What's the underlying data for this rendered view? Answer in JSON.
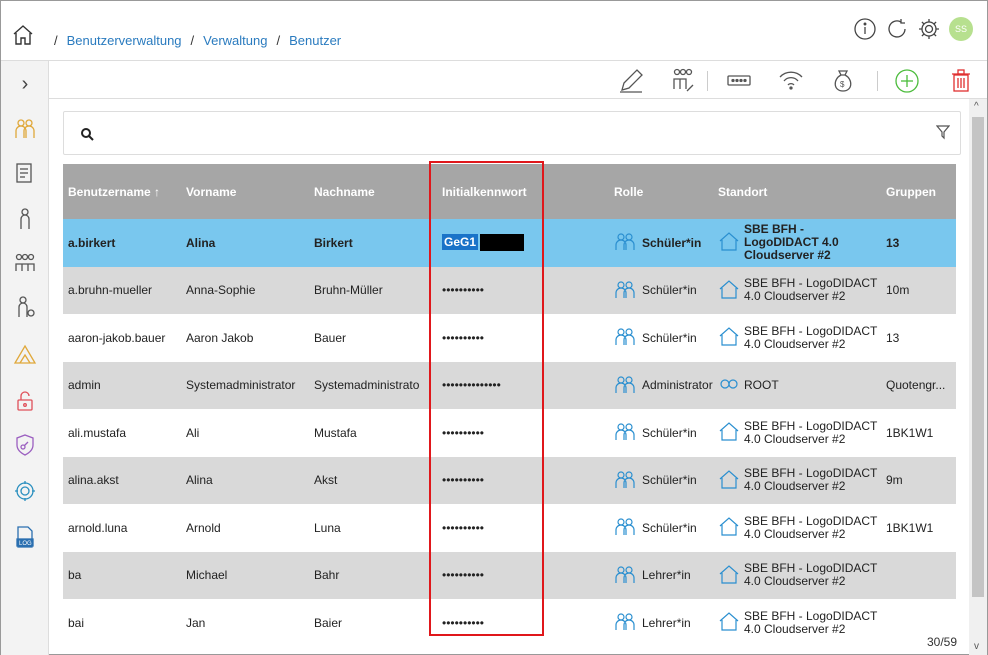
{
  "breadcrumb": {
    "items": [
      "Benutzerverwaltung",
      "Verwaltung",
      "Benutzer"
    ],
    "separator": "/"
  },
  "header": {
    "avatar": "SS",
    "info_icon": "info-icon",
    "refresh_icon": "refresh-icon",
    "settings_icon": "gear-icon"
  },
  "sidebar": {
    "expand": "›",
    "icons": [
      "users-group-icon",
      "report-icon",
      "single-user-icon",
      "group-icon",
      "user-admin-icon",
      "triangle-warning-icon",
      "unlock-icon",
      "shield-key-icon",
      "settings-users-icon",
      "log-icon"
    ]
  },
  "search": {
    "placeholder": "",
    "value": ""
  },
  "table": {
    "headers": [
      "Benutzername ↑",
      "Vorname",
      "Nachname",
      "Initialkennwort",
      "Rolle",
      "Standort",
      "Gruppen"
    ],
    "rows": [
      {
        "user": "a.birkert",
        "first": "Alina",
        "last": "Birkert",
        "pw": "GeG1",
        "role": "Schüler*in",
        "site": "SBE BFH - LogoDIDACT 4.0 Cloudserver #2",
        "groups": "13"
      },
      {
        "user": "a.bruhn-mueller",
        "first": "Anna-Sophie",
        "last": "Bruhn-Müller",
        "pw": "••••••••••",
        "role": "Schüler*in",
        "site": "SBE BFH - LogoDIDACT 4.0 Cloudserver #2",
        "groups": "10m"
      },
      {
        "user": "aaron-jakob.bauer",
        "first": "Aaron Jakob",
        "last": "Bauer",
        "pw": "••••••••••",
        "role": "Schüler*in",
        "site": "SBE BFH - LogoDIDACT 4.0 Cloudserver #2",
        "groups": "13"
      },
      {
        "user": "admin",
        "first": "Systemadministrator",
        "last": "Systemadministrato",
        "pw": "••••••••••••••",
        "role": "Administrator*in",
        "site": "ROOT",
        "groups": "Quotengr..."
      },
      {
        "user": "ali.mustafa",
        "first": "Ali",
        "last": "Mustafa",
        "pw": "••••••••••",
        "role": "Schüler*in",
        "site": "SBE BFH - LogoDIDACT 4.0 Cloudserver #2",
        "groups": "1BK1W1"
      },
      {
        "user": "alina.akst",
        "first": "Alina",
        "last": "Akst",
        "pw": "••••••••••",
        "role": "Schüler*in",
        "site": "SBE BFH - LogoDIDACT 4.0 Cloudserver #2",
        "groups": "9m"
      },
      {
        "user": "arnold.luna",
        "first": "Arnold",
        "last": "Luna",
        "pw": "••••••••••",
        "role": "Schüler*in",
        "site": "SBE BFH - LogoDIDACT 4.0 Cloudserver #2",
        "groups": "1BK1W1"
      },
      {
        "user": "ba",
        "first": "Michael",
        "last": "Bahr",
        "pw": "••••••••••",
        "role": "Lehrer*in",
        "site": "SBE BFH - LogoDIDACT 4.0 Cloudserver #2",
        "groups": ""
      },
      {
        "user": "bai",
        "first": "Jan",
        "last": "Baier",
        "pw": "••••••••••",
        "role": "Lehrer*in",
        "site": "SBE BFH - LogoDIDACT 4.0 Cloudserver #2",
        "groups": ""
      }
    ]
  },
  "pagination": {
    "count": "30/59"
  },
  "toolbar": {
    "icons": [
      "edit-icon",
      "edit-group-icon",
      "password-icon",
      "wifi-edit-icon",
      "quota-edit-icon",
      "add-icon",
      "delete-icon"
    ]
  },
  "colors": {
    "header_bg": "#a6a6a6",
    "selected_row": "#79c7ee",
    "stripe": "#d9d9d9",
    "accent": "#2a7bbf",
    "highlight_box": "#e0171b",
    "add": "#4cbc3c",
    "delete": "#e03030"
  }
}
